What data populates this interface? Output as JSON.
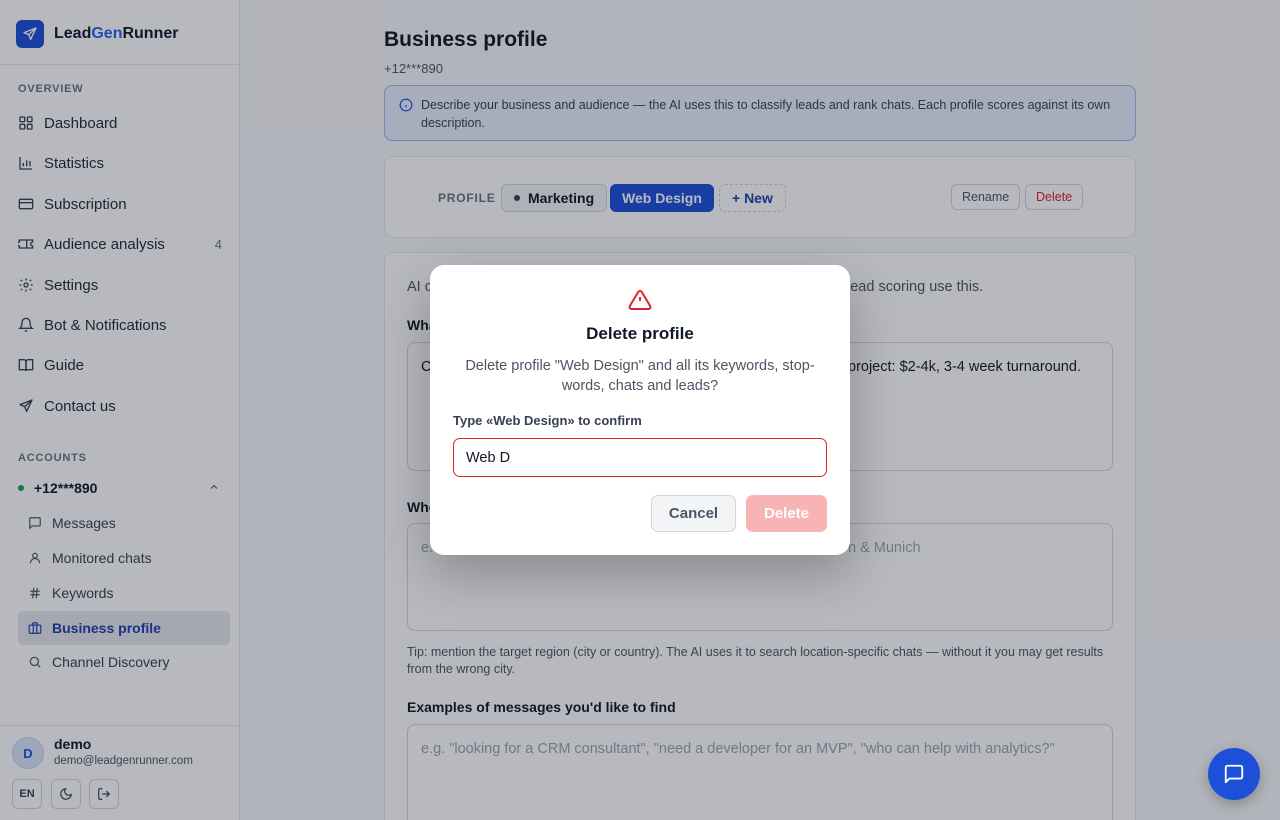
{
  "brand": {
    "part1": "Lead",
    "part2": "Gen",
    "part3": "Runner"
  },
  "sidebar": {
    "overview_title": "OVERVIEW",
    "items": [
      {
        "label": "Dashboard",
        "icon": "grid-icon"
      },
      {
        "label": "Statistics",
        "icon": "bar-chart-icon"
      },
      {
        "label": "Subscription",
        "icon": "credit-card-icon"
      },
      {
        "label": "Audience analysis",
        "icon": "ticket-icon",
        "badge": "4"
      },
      {
        "label": "Settings",
        "icon": "gear-icon"
      },
      {
        "label": "Bot & Notifications",
        "icon": "bell-icon"
      },
      {
        "label": "Guide",
        "icon": "book-icon"
      },
      {
        "label": "Contact us",
        "icon": "send-icon"
      }
    ],
    "accounts_title": "ACCOUNTS",
    "account": "+12***890",
    "sub_items": [
      {
        "label": "Messages",
        "icon": "message-icon"
      },
      {
        "label": "Monitored chats",
        "icon": "user-icon"
      },
      {
        "label": "Keywords",
        "icon": "hash-icon"
      },
      {
        "label": "Business profile",
        "icon": "briefcase-icon",
        "active": true
      },
      {
        "label": "Channel Discovery",
        "icon": "search-icon"
      }
    ],
    "user": {
      "initial": "D",
      "name": "demo",
      "email": "demo@leadgenrunner.com",
      "lang": "EN"
    }
  },
  "main": {
    "title": "Business profile",
    "subtitle": "+12***890",
    "info": "Describe your business and audience — the AI uses this to classify leads and rank chats. Each profile scores against its own description.",
    "profile_label": "PROFILE",
    "profiles": [
      "Marketing",
      "Web Design"
    ],
    "new_label": "+ New",
    "rename_label": "Rename",
    "delete_label": "Delete",
    "form": {
      "intro_left": "AI c",
      "intro_right": "lead scoring use this.",
      "q1_label": "Wha",
      "q1_value_left": "C",
      "q1_value_right": "project: $2-4k, 3-4 week turnaround.",
      "q2_label": "Whe",
      "q2_placeholder_left": "e.",
      "q2_placeholder_right": "n & Munich",
      "tip": "Tip: mention the target region (city or country). The AI uses it to search location-specific chats — without it you may get results from the wrong city.",
      "q3_label": "Examples of messages you'd like to find",
      "q3_placeholder": "e.g. \"looking for a CRM consultant\", \"need a developer for an MVP\", \"who can help with analytics?\""
    }
  },
  "modal": {
    "title": "Delete profile",
    "description": "Delete profile \"Web Design\" and all its keywords, stop-words, chats and leads?",
    "confirm_label": "Type «Web Design» to confirm",
    "input_value": "Web D",
    "cancel": "Cancel",
    "delete": "Delete"
  },
  "colors": {
    "accent": "#1e4fd8",
    "danger": "#dc2626",
    "danger_disabled": "#f8b4b4"
  }
}
